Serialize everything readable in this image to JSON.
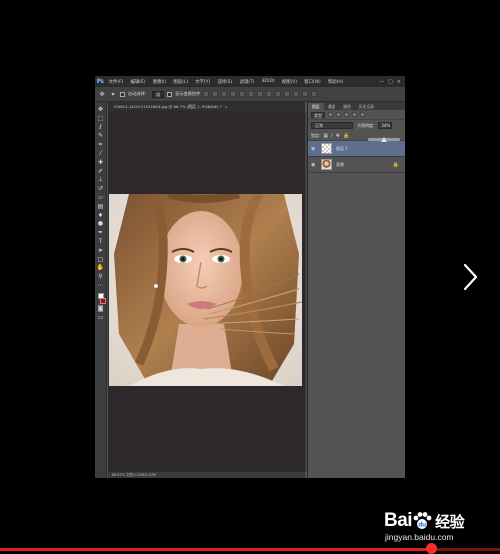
{
  "app": {
    "logo": "Ps",
    "menu": [
      "文件(F)",
      "编辑(E)",
      "图像(I)",
      "图层(L)",
      "文字(Y)",
      "选择(S)",
      "滤镜(T)",
      "3D(D)",
      "视图(V)",
      "窗口(W)",
      "帮助(H)"
    ],
    "window_controls": [
      "—",
      "□",
      "×"
    ]
  },
  "options_bar": {
    "auto_select_label": "自动选择：",
    "auto_select_value": "组",
    "show_transform_label": "显示变换控件"
  },
  "document": {
    "tab_title": "150612-1410151541864.jpg @ 66.7% (图层 1, RGB/8#) *",
    "close_glyph": "×",
    "status_text": "66.67%    文档:1.03M/2.07M"
  },
  "panels": {
    "tabs": [
      "图层",
      "通道",
      "路径",
      "历史记录"
    ],
    "kind_label": "类型",
    "blend_mode": "正常",
    "opacity_label": "不透明度:",
    "opacity_value": "34%",
    "lock_label": "锁定:",
    "fill_label": "填充:",
    "layers": [
      {
        "name": "图层 1",
        "selected": true
      },
      {
        "name": "背景",
        "selected": false,
        "locked": true
      }
    ],
    "opacity_fraction": 0.34
  },
  "overlay": {
    "next_icon": "chevron-right-icon"
  },
  "watermark": {
    "brand_left": "Bai",
    "brand_right": "经验",
    "url": "jingyan.baidu.com"
  },
  "video": {
    "progress_fraction": 0.87,
    "played_color": "#e21f1f",
    "track_color": "#7a1010"
  },
  "colors": {
    "ps_accent": "#7ab4ff",
    "selected_layer": "#5c6f8e",
    "background_swatch": "#c40000"
  }
}
